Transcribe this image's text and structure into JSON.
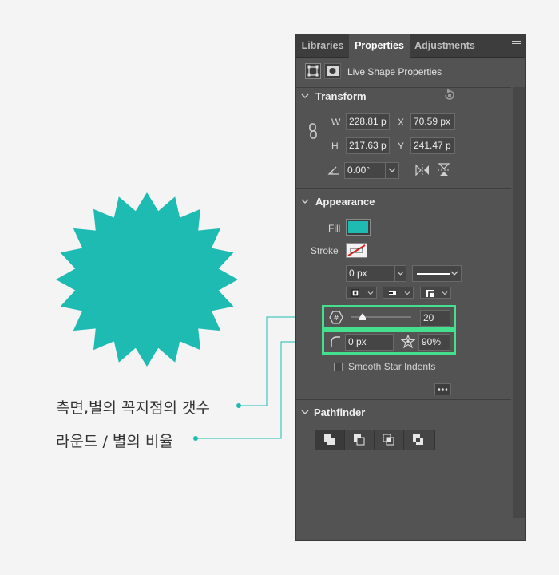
{
  "colors": {
    "shape_fill": "#1ebbb3",
    "highlight": "#45e08e",
    "panel_bg": "#535353"
  },
  "callouts": {
    "sides_count": "측면,별의 꼭지점의 갯수",
    "round_ratio": "라운드 / 별의 비율"
  },
  "tabs": [
    {
      "label": "Libraries",
      "active": false
    },
    {
      "label": "Properties",
      "active": true
    },
    {
      "label": "Adjustments",
      "active": false
    }
  ],
  "header": {
    "title": "Live Shape Properties"
  },
  "transform": {
    "title": "Transform",
    "w_label": "W",
    "w_value": "228.81 p",
    "x_label": "X",
    "x_value": "70.59 px",
    "h_label": "H",
    "h_value": "217.63 p",
    "y_label": "Y",
    "y_value": "241.47 p",
    "angle_value": "0.00°"
  },
  "appearance": {
    "title": "Appearance",
    "fill_label": "Fill",
    "stroke_label": "Stroke",
    "stroke_width": "0 px",
    "sides_value": "20",
    "slider_value": 0.2,
    "corner_radius": "0 px",
    "star_ratio": "90%",
    "smooth_label": "Smooth Star Indents",
    "smooth_checked": false
  },
  "pathfinder": {
    "title": "Pathfinder"
  }
}
